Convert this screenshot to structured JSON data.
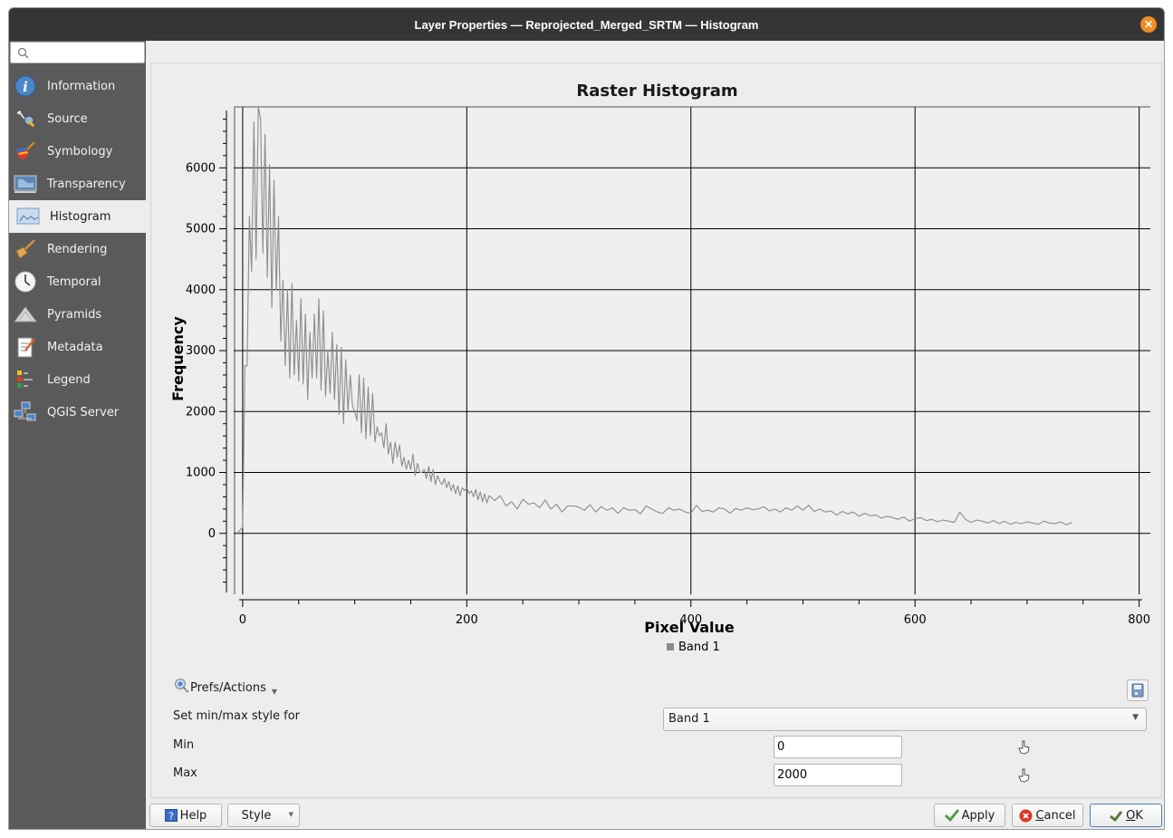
{
  "window": {
    "title": "Layer Properties — Reprojected_Merged_SRTM — Histogram",
    "close_icon": "close-icon"
  },
  "sidebar": {
    "search_placeholder": "",
    "items": [
      {
        "label": "Information",
        "icon": "information-icon",
        "active": false
      },
      {
        "label": "Source",
        "icon": "source-icon",
        "active": false
      },
      {
        "label": "Symbology",
        "icon": "symbology-icon",
        "active": false
      },
      {
        "label": "Transparency",
        "icon": "transparency-icon",
        "active": false
      },
      {
        "label": "Histogram",
        "icon": "histogram-icon",
        "active": true
      },
      {
        "label": "Rendering",
        "icon": "rendering-icon",
        "active": false
      },
      {
        "label": "Temporal",
        "icon": "temporal-icon",
        "active": false
      },
      {
        "label": "Pyramids",
        "icon": "pyramids-icon",
        "active": false
      },
      {
        "label": "Metadata",
        "icon": "metadata-icon",
        "active": false
      },
      {
        "label": "Legend",
        "icon": "legend-icon",
        "active": false
      },
      {
        "label": "QGIS Server",
        "icon": "qgis-server-icon",
        "active": false
      }
    ]
  },
  "chart_data": {
    "type": "line",
    "title": "Raster Histogram",
    "xlabel": "Pixel Value",
    "ylabel": "Frequency",
    "xlim": [
      -8,
      810
    ],
    "ylim": [
      -1000,
      7000
    ],
    "x_ticks": [
      0,
      200,
      400,
      600,
      800
    ],
    "y_ticks": [
      0,
      1000,
      2000,
      3000,
      4000,
      5000,
      6000
    ],
    "grid": true,
    "legend": {
      "position": "bottom-center",
      "entries": [
        "Band 1"
      ]
    },
    "series": [
      {
        "name": "Band 1",
        "color": "#8c8c8c",
        "x": [
          -5,
          0,
          2,
          4,
          6,
          8,
          10,
          12,
          14,
          16,
          18,
          20,
          22,
          24,
          26,
          28,
          30,
          32,
          34,
          36,
          38,
          40,
          42,
          44,
          46,
          48,
          50,
          52,
          54,
          56,
          58,
          60,
          62,
          64,
          66,
          68,
          70,
          72,
          74,
          76,
          78,
          80,
          82,
          84,
          86,
          88,
          90,
          92,
          94,
          96,
          98,
          100,
          102,
          104,
          106,
          108,
          110,
          112,
          114,
          116,
          118,
          120,
          122,
          124,
          126,
          128,
          130,
          132,
          134,
          136,
          138,
          140,
          142,
          144,
          146,
          148,
          150,
          152,
          154,
          156,
          158,
          160,
          162,
          164,
          166,
          168,
          170,
          172,
          174,
          176,
          178,
          180,
          182,
          184,
          186,
          188,
          190,
          192,
          194,
          196,
          198,
          200,
          202,
          204,
          206,
          208,
          210,
          212,
          214,
          216,
          218,
          220,
          225,
          230,
          235,
          240,
          245,
          250,
          255,
          260,
          265,
          270,
          275,
          280,
          285,
          290,
          295,
          300,
          305,
          310,
          315,
          320,
          325,
          330,
          335,
          340,
          345,
          350,
          355,
          360,
          365,
          370,
          375,
          380,
          385,
          390,
          395,
          400,
          405,
          410,
          415,
          420,
          425,
          430,
          435,
          440,
          445,
          450,
          455,
          460,
          465,
          470,
          475,
          480,
          485,
          490,
          495,
          500,
          505,
          510,
          515,
          520,
          525,
          530,
          535,
          540,
          545,
          550,
          555,
          560,
          565,
          570,
          575,
          580,
          585,
          590,
          595,
          600,
          605,
          610,
          615,
          620,
          625,
          630,
          635,
          640,
          645,
          650,
          655,
          660,
          665,
          670,
          675,
          680,
          685,
          690,
          695,
          700,
          705,
          710,
          715,
          720,
          725,
          730,
          735,
          740,
          745,
          750,
          755,
          760,
          765,
          770,
          775,
          780,
          785,
          790,
          795,
          800,
          805,
          810
        ],
        "values": [
          0,
          100,
          2750,
          2750,
          5200,
          4300,
          6750,
          4500,
          7000,
          6800,
          4600,
          6550,
          4200,
          6050,
          3700,
          5800,
          4000,
          5200,
          3150,
          4150,
          2750,
          4000,
          2550,
          4100,
          2600,
          3500,
          2500,
          3850,
          2450,
          3600,
          2200,
          3300,
          2550,
          3600,
          2550,
          3850,
          2350,
          3650,
          2250,
          3000,
          2300,
          3300,
          2200,
          3100,
          1950,
          3050,
          1800,
          2850,
          2000,
          2600,
          2100,
          2000,
          1850,
          2600,
          1650,
          2550,
          1550,
          2400,
          1600,
          2300,
          1500,
          1750,
          1600,
          1650,
          1400,
          1800,
          1300,
          1500,
          1150,
          1500,
          1250,
          1450,
          1100,
          1250,
          1050,
          1200,
          1050,
          1300,
          950,
          1150,
          1000,
          1000,
          1050,
          900,
          1100,
          850,
          1050,
          800,
          950,
          850,
          800,
          900,
          750,
          850,
          700,
          800,
          650,
          780,
          620,
          750,
          700,
          750,
          650,
          700,
          600,
          720,
          550,
          680,
          520,
          650,
          500,
          620,
          540,
          620,
          450,
          520,
          400,
          560,
          480,
          500,
          420,
          550,
          400,
          480,
          350,
          450,
          450,
          430,
          380,
          470,
          350,
          440,
          380,
          420,
          330,
          420,
          380,
          390,
          320,
          450,
          400,
          350,
          330,
          420,
          380,
          400,
          350,
          330,
          460,
          360,
          380,
          350,
          420,
          400,
          330,
          410,
          380,
          420,
          390,
          400,
          440,
          370,
          400,
          350,
          420,
          380,
          450,
          380,
          460,
          360,
          400,
          350,
          370,
          300,
          360,
          320,
          350,
          280,
          330,
          290,
          300,
          250,
          280,
          260,
          230,
          270,
          200,
          240,
          260,
          210,
          230,
          190,
          220,
          200,
          180,
          350,
          230,
          180,
          220,
          200,
          170,
          210,
          160,
          200,
          150,
          180,
          160,
          190,
          170,
          150,
          200,
          170,
          160,
          190,
          140,
          180
        ]
      }
    ]
  },
  "controls": {
    "prefs_label": "Prefs/Actions",
    "prefs_icon": "prefs-actions-icon",
    "save_icon": "save-icon",
    "minmax_label": "Set min/max style for",
    "band_select": "Band 1",
    "min_label": "Min",
    "min_value": "0",
    "max_label": "Max",
    "max_value": "2000"
  },
  "buttons": {
    "help": "Help",
    "style": "Style",
    "apply": "Apply",
    "cancel_prefix": "",
    "cancel_u": "C",
    "cancel_rest": "ancel",
    "ok_u": "O",
    "ok_rest": "K"
  }
}
